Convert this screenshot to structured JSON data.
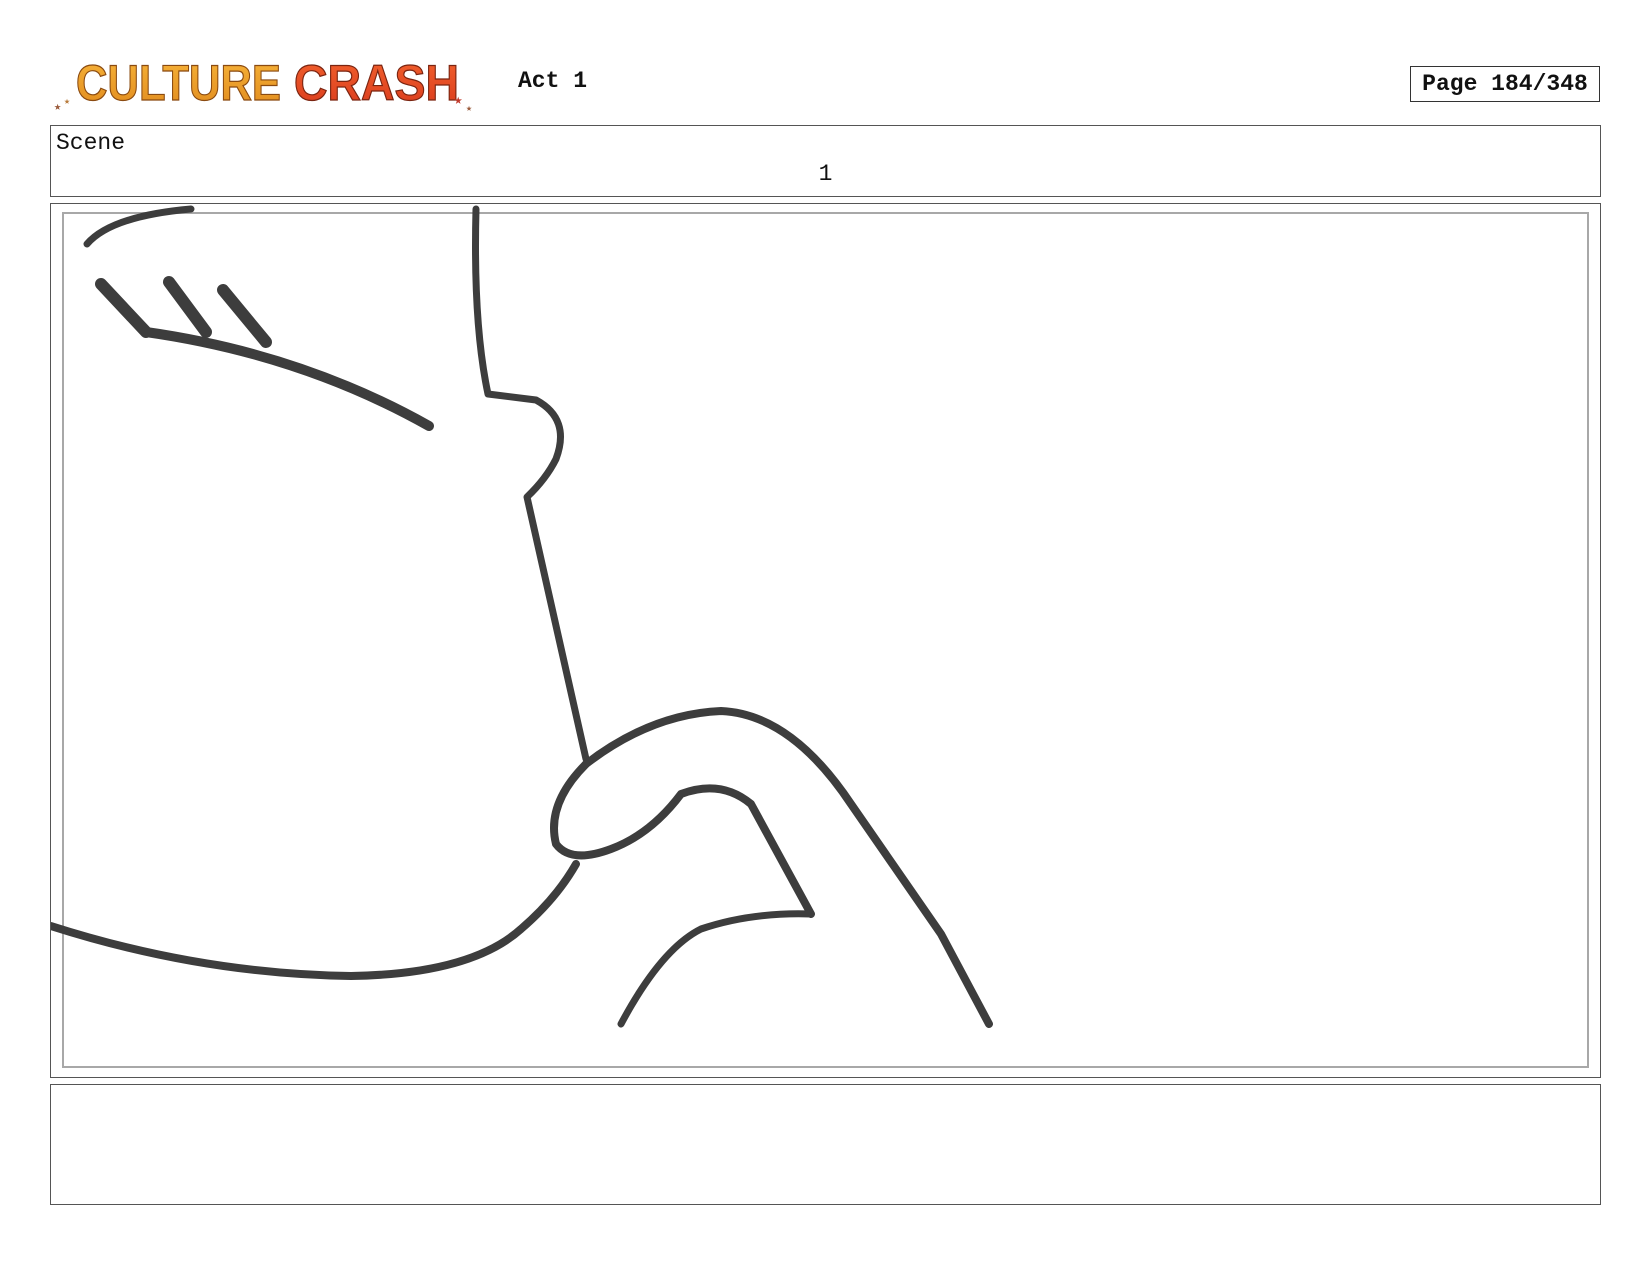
{
  "header": {
    "logo_text": "CULTURE CRASH",
    "act": "Act 1",
    "page": "Page 184/348"
  },
  "scene": {
    "label": "Scene",
    "number": "1"
  },
  "notes": {
    "text": ""
  }
}
